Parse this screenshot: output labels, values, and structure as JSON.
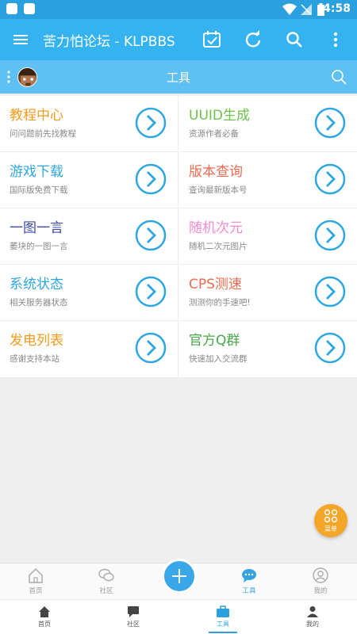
{
  "status_bar": {
    "time": "4:58"
  },
  "app_bar": {
    "title": "苦力怕论坛 - KLPBBS"
  },
  "sub_bar": {
    "title": "工具"
  },
  "tools": [
    {
      "title": "教程中心",
      "subtitle": "问问题前先找教程",
      "color": "#f29b1d"
    },
    {
      "title": "UUID生成",
      "subtitle": "资源作者必备",
      "color": "#6cc24a"
    },
    {
      "title": "游戏下载",
      "subtitle": "国际版免费下载",
      "color": "#2ea7e0"
    },
    {
      "title": "版本查询",
      "subtitle": "查询最新版本号",
      "color": "#f06b4f"
    },
    {
      "title": "一图一言",
      "subtitle": "萎块的一图一言",
      "color": "#3b4ba8"
    },
    {
      "title": "随机次元",
      "subtitle": "随机二次元图片",
      "color": "#f28ad2"
    },
    {
      "title": "系统状态",
      "subtitle": "相关服务器状态",
      "color": "#2ea7e0"
    },
    {
      "title": "CPS测速",
      "subtitle": "测测你的手速吧!",
      "color": "#f06b4f"
    },
    {
      "title": "发电列表",
      "subtitle": "感谢支持本站",
      "color": "#f29b1d"
    },
    {
      "title": "官方Q群",
      "subtitle": "快速加入交流群",
      "color": "#4aa84a"
    }
  ],
  "fab_menu": {
    "label": "菜单"
  },
  "tabbar_top": [
    {
      "label": "首页",
      "icon": "home-outline-icon"
    },
    {
      "label": "社区",
      "icon": "chat-bubbles-outline-icon"
    },
    {
      "label": "工具",
      "icon": "chat-bubble-filled-icon",
      "active": true
    },
    {
      "label": "我的",
      "icon": "person-circle-outline-icon"
    }
  ],
  "tabbar_bottom": [
    {
      "label": "首页",
      "icon": "home-icon"
    },
    {
      "label": "社区",
      "icon": "comment-icon"
    },
    {
      "label": "工具",
      "icon": "briefcase-icon",
      "active": true
    },
    {
      "label": "我的",
      "icon": "person-icon"
    }
  ],
  "colors": {
    "primary": "#34b3f0",
    "accent": "#2aa0de",
    "fab": "#f4a628"
  }
}
